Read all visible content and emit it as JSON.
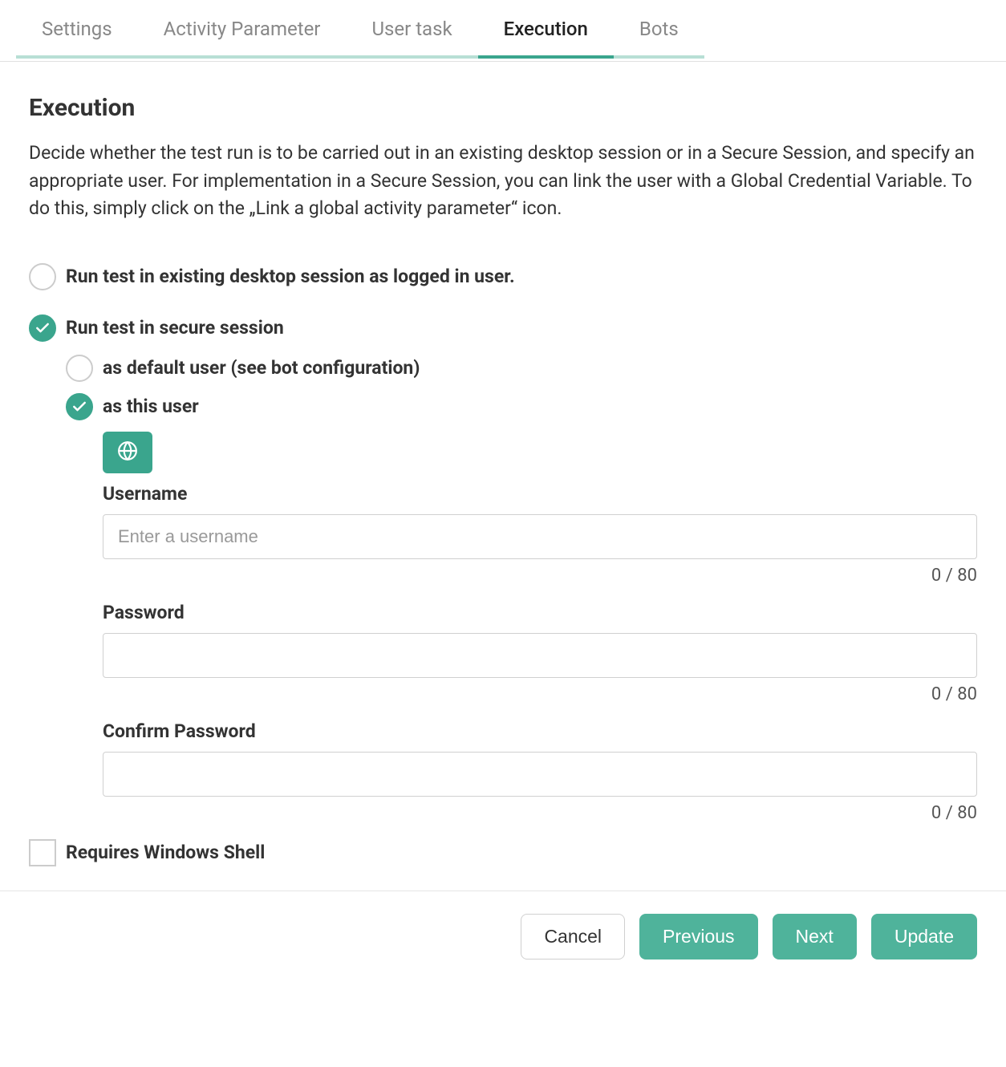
{
  "tabs": {
    "settings": "Settings",
    "activity_parameter": "Activity Parameter",
    "user_task": "User task",
    "execution": "Execution",
    "bots": "Bots"
  },
  "page": {
    "title": "Execution",
    "description": "Decide whether the test run is to be carried out in an existing desktop session or in a Secure Session, and specify an appropriate user. For implementation in a Secure Session, you can link the user with a Global Credential Variable. To do this, simply click on the „Link a global activity parameter“ icon."
  },
  "options": {
    "existing_session": "Run test in existing desktop session as logged in user.",
    "secure_session": "Run test in secure session",
    "as_default_user": "as default user (see bot configuration)",
    "as_this_user": "as this user"
  },
  "form": {
    "username_label": "Username",
    "username_placeholder": "Enter a username",
    "username_value": "",
    "username_counter": "0 / 80",
    "password_label": "Password",
    "password_value": "",
    "password_counter": "0 / 80",
    "confirm_label": "Confirm Password",
    "confirm_value": "",
    "confirm_counter": "0 / 80"
  },
  "checkbox": {
    "requires_shell": "Requires Windows Shell"
  },
  "footer": {
    "cancel": "Cancel",
    "previous": "Previous",
    "next": "Next",
    "update": "Update"
  }
}
